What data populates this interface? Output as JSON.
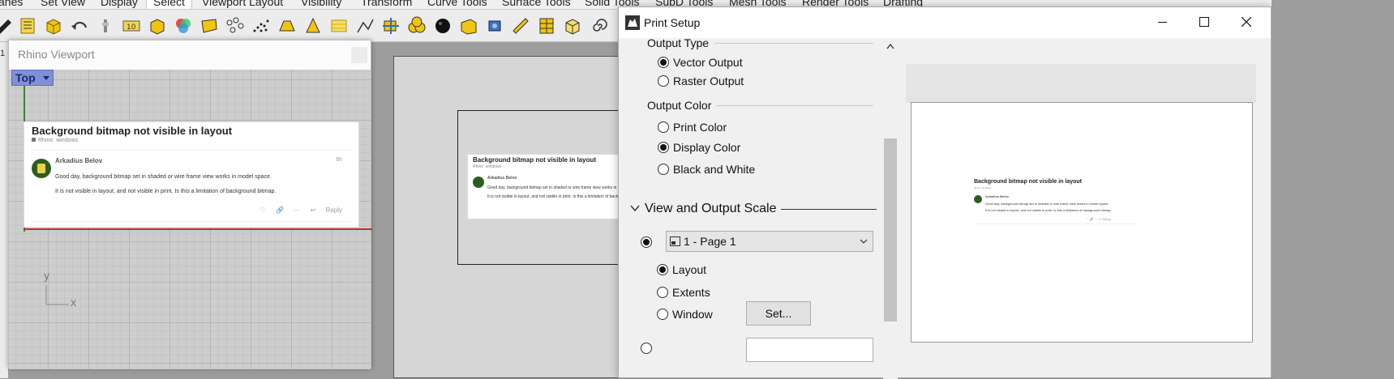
{
  "menu_tabs": [
    {
      "label": "anes",
      "selected": false
    },
    {
      "label": "Set View",
      "selected": false
    },
    {
      "label": "Display",
      "selected": false
    },
    {
      "label": "Select",
      "selected": true
    },
    {
      "label": "Viewport Layout",
      "selected": false
    },
    {
      "label": "Visibility",
      "selected": false
    },
    {
      "label": "Transform",
      "selected": false
    },
    {
      "label": "Curve Tools",
      "selected": false
    },
    {
      "label": "Surface Tools",
      "selected": false
    },
    {
      "label": "Solid Tools",
      "selected": false
    },
    {
      "label": "SubD Tools",
      "selected": false
    },
    {
      "label": "Mesh Tools",
      "selected": false
    },
    {
      "label": "Render Tools",
      "selected": false
    },
    {
      "label": "Drafting",
      "selected": false
    }
  ],
  "toolbar_icons": [
    "pencil-icon",
    "list-icon",
    "box-select-icon",
    "undo-icon",
    "lamp-icon",
    "label-select-icon",
    "cube-select-icon",
    "color-wheel-icon",
    "mesh-select-icon",
    "control-points-icon",
    "point-cloud-icon",
    "solid-select-icon",
    "cone-select-icon",
    "surface-select-icon",
    "polyline-select-icon",
    "move-select-icon",
    "group-select-icon",
    "sphere-select-icon",
    "block-select-icon",
    "camera-select-icon",
    "dimension-select-icon",
    "hatch-select-icon",
    "box-3d-select-icon",
    "spiral-select-icon"
  ],
  "left_strip": {
    "text": "1"
  },
  "rhino_viewport": {
    "title": "Rhino Viewport",
    "view_button": "Top",
    "axis_y": "y",
    "axis_x": "x"
  },
  "forum_post": {
    "title": "Background bitmap not visible in layout",
    "category": "Rhino",
    "tag": "windows",
    "author": "Arkadius Belov",
    "time": "6h",
    "body1": "Good day, background bitmap set in shaded or wire frame view works in model space.",
    "body2": "It is not visible in layout, and not visible in print. Is this a limitation of background bitmap.",
    "reply_label": "Reply"
  },
  "print_setup": {
    "title": "Print Setup",
    "output_type": {
      "heading": "Output Type",
      "options": [
        {
          "label": "Vector Output",
          "checked": true
        },
        {
          "label": "Raster Output",
          "checked": false
        }
      ]
    },
    "output_color": {
      "heading": "Output Color",
      "options": [
        {
          "label": "Print Color",
          "checked": false
        },
        {
          "label": "Display Color",
          "checked": true
        },
        {
          "label": "Black and White",
          "checked": false
        }
      ]
    },
    "view_scale": {
      "heading": "View and Output Scale",
      "page_select_value": "1 - Page 1",
      "options": [
        {
          "label": "Layout",
          "checked": true
        },
        {
          "label": "Extents",
          "checked": false
        },
        {
          "label": "Window",
          "checked": false
        }
      ],
      "set_button": "Set..."
    }
  },
  "colors": {
    "viewport_button": "#7f90d8",
    "dialog_bg": "#f0f0f0",
    "workspace_bg": "#9d9d9d"
  }
}
